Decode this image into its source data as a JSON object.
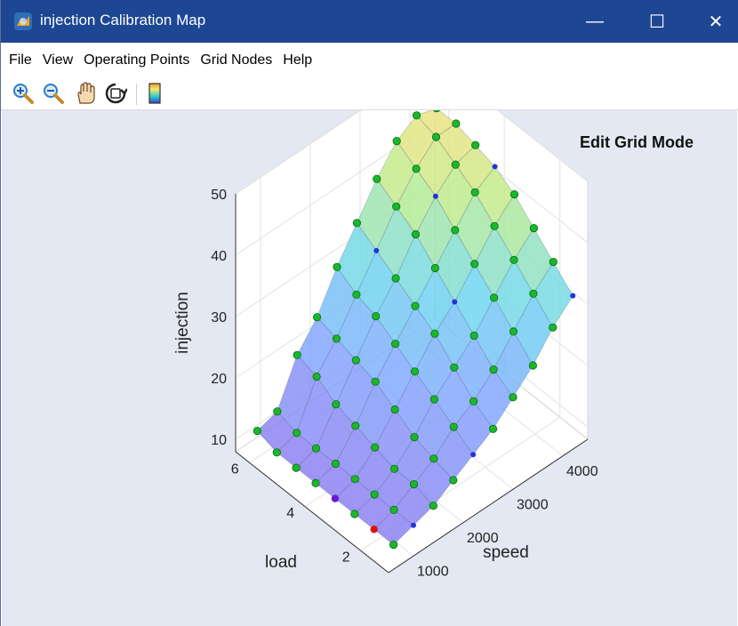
{
  "window": {
    "title": "injection Calibration Map",
    "icon": "matlab-app-icon",
    "controls": {
      "minimize": "—",
      "maximize": "☐",
      "close": "✕"
    }
  },
  "menu": [
    "File",
    "View",
    "Operating Points",
    "Grid Nodes",
    "Help"
  ],
  "toolbar": {
    "tools": [
      "zoom-in-icon",
      "zoom-out-icon",
      "pan-hand-icon",
      "rotate-3d-icon",
      "colorbar-icon"
    ]
  },
  "plot": {
    "mode_label": "Edit Grid Mode",
    "colors": {
      "background": "#e4e8f2",
      "node_green": "#18b82a",
      "node_blue": "#2233dd",
      "node_red": "#dd1111"
    }
  },
  "chart_data": {
    "type": "surface",
    "xlabel": "speed",
    "ylabel": "load",
    "zlabel": "injection",
    "x_ticks": [
      "1000",
      "2000",
      "3000",
      "4000"
    ],
    "y_ticks": [
      "2",
      "4",
      "6"
    ],
    "z_ticks": [
      "10",
      "20",
      "30",
      "40",
      "50"
    ],
    "xlim": [
      500,
      4500
    ],
    "ylim": [
      1,
      6.5
    ],
    "zlim": [
      8,
      50
    ],
    "grid": true,
    "speed_nodes": [
      600,
      1000,
      1400,
      1800,
      2200,
      2600,
      3000,
      3400,
      3800,
      4200
    ],
    "load_nodes": [
      1.0,
      1.7,
      2.4,
      3.1,
      3.8,
      4.5,
      5.2,
      5.9
    ],
    "injection": [
      [
        12,
        12,
        12,
        12,
        12,
        12,
        12,
        13
      ],
      [
        13,
        13,
        13,
        13,
        13,
        13,
        13,
        14
      ],
      [
        14,
        15,
        15,
        16,
        17,
        18,
        20,
        21
      ],
      [
        16,
        17,
        18,
        20,
        22,
        23,
        24,
        25
      ],
      [
        18,
        20,
        22,
        24,
        26,
        28,
        29,
        31
      ],
      [
        20,
        22,
        25,
        28,
        30,
        32,
        34,
        36
      ],
      [
        23,
        25,
        28,
        31,
        34,
        37,
        39,
        41
      ],
      [
        26,
        29,
        32,
        35,
        38,
        41,
        43,
        45
      ],
      [
        30,
        33,
        36,
        39,
        42,
        44,
        46,
        47
      ],
      [
        33,
        36,
        39,
        42,
        44,
        45,
        46,
        46
      ]
    ],
    "node_status": [
      [
        "green",
        "red",
        "green",
        "purple",
        "green",
        "green",
        "green",
        "green"
      ],
      [
        "blue",
        "green",
        "green",
        "green",
        "green",
        "green",
        "green",
        "green"
      ],
      [
        "green",
        "green",
        "green",
        "green",
        "green",
        "green",
        "green",
        "green"
      ],
      [
        "green",
        "green",
        "green",
        "green",
        "green",
        "green",
        "green",
        "green"
      ],
      [
        "blue",
        "green",
        "green",
        "green",
        "green",
        "green",
        "green",
        "green"
      ],
      [
        "green",
        "green",
        "green",
        "green",
        "green",
        "green",
        "blue",
        "green"
      ],
      [
        "green",
        "green",
        "green",
        "blue",
        "green",
        "green",
        "green",
        "green"
      ],
      [
        "green",
        "green",
        "green",
        "green",
        "green",
        "blue",
        "green",
        "green"
      ],
      [
        "green",
        "green",
        "green",
        "green",
        "green",
        "green",
        "green",
        "green"
      ],
      [
        "blue",
        "green",
        "green",
        "green",
        "blue",
        "green",
        "green",
        "green"
      ]
    ]
  }
}
